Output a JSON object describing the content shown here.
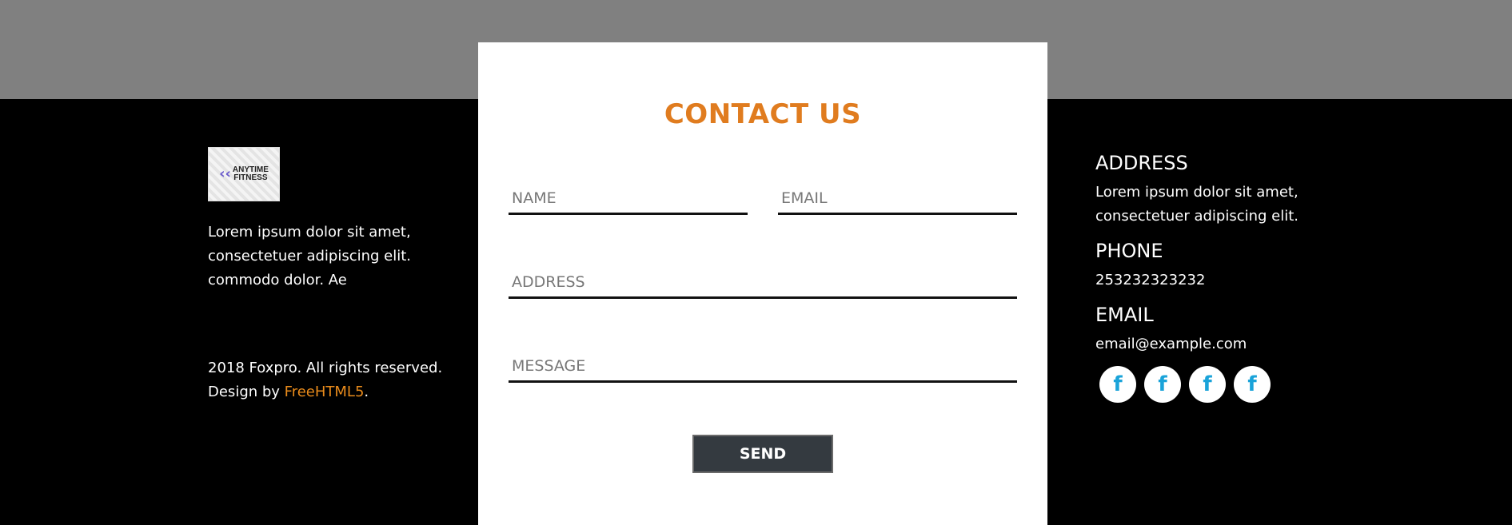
{
  "left": {
    "logo": {
      "line1": "ANYTIME",
      "line2": "FITNESS",
      "mark": "‹‹"
    },
    "description": "Lorem ipsum dolor sit amet, consectetuer adipiscing elit. commodo dolor. Ae",
    "copyright_line1": "2018 Foxpro. All rights reserved.",
    "copyright_prefix": "Design by ",
    "copyright_link": "FreeHTML5",
    "copyright_suffix": "."
  },
  "contact_form": {
    "title": "CONTACT US",
    "name_placeholder": "NAME",
    "email_placeholder": "EMAIL",
    "address_placeholder": "ADDRESS",
    "message_placeholder": "MESSAGE",
    "send_label": "SEND"
  },
  "right": {
    "address_heading": "ADDRESS",
    "address_text": "Lorem ipsum dolor sit amet, consectetuer adipiscing elit.",
    "phone_heading": "PHONE",
    "phone_text": "253232323232",
    "email_heading": "EMAIL",
    "email_text": "email@example.com",
    "socials": [
      {
        "icon": "facebook-icon",
        "glyph": "f"
      },
      {
        "icon": "facebook-icon",
        "glyph": "f"
      },
      {
        "icon": "facebook-icon",
        "glyph": "f"
      },
      {
        "icon": "facebook-icon",
        "glyph": "f"
      }
    ]
  },
  "colors": {
    "accent": "#e07c1f",
    "link": "#e98b1b",
    "social_icon": "#1aa3d9",
    "top_band": "#808080",
    "footer_bg": "#000000",
    "button_bg": "#343a40"
  }
}
